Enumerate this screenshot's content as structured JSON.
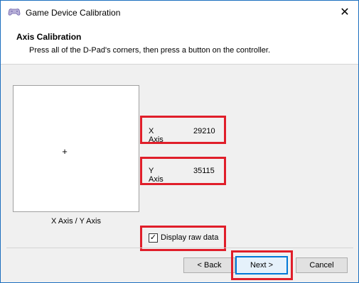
{
  "window": {
    "title": "Game Device Calibration"
  },
  "header": {
    "title": "Axis Calibration",
    "subtitle": "Press all of the D-Pad's corners, then press a button on the controller."
  },
  "calibration": {
    "crosshair": "+",
    "canvas_label": "X Axis / Y Axis",
    "x_axis": {
      "label": "X Axis",
      "value": "29210"
    },
    "y_axis": {
      "label": "Y Axis",
      "value": "35115"
    },
    "raw_data": {
      "label": "Display raw data",
      "checked": true,
      "check_glyph": "✓"
    }
  },
  "buttons": {
    "back": "< Back",
    "next": "Next >",
    "cancel": "Cancel"
  },
  "icons": {
    "close": "✕",
    "app": "gamepad-icon"
  },
  "colors": {
    "highlight": "#e01e2a",
    "primary_border": "#0078d7"
  }
}
